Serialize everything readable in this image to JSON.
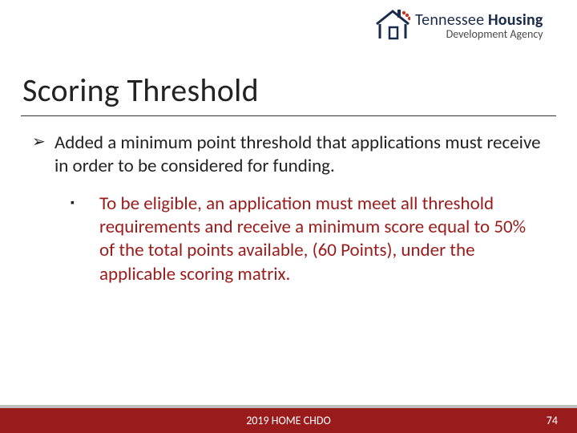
{
  "logo": {
    "line1_part1": "Tennessee",
    "line1_part2": "Housing",
    "line2": "Development Agency"
  },
  "title": "Scoring Threshold",
  "bullets": {
    "lvl1": "Added a minimum point threshold that applications must receive in order to be considered for funding.",
    "lvl2": "To be eligible, an application must meet all threshold requirements and receive a minimum score equal to 50% of the total points available, (60 Points), under the applicable scoring matrix."
  },
  "footer": {
    "center": "2019 HOME CHDO",
    "page": "74"
  },
  "colors": {
    "accent": "#9a1b1b",
    "navy": "#1b2b4b"
  }
}
